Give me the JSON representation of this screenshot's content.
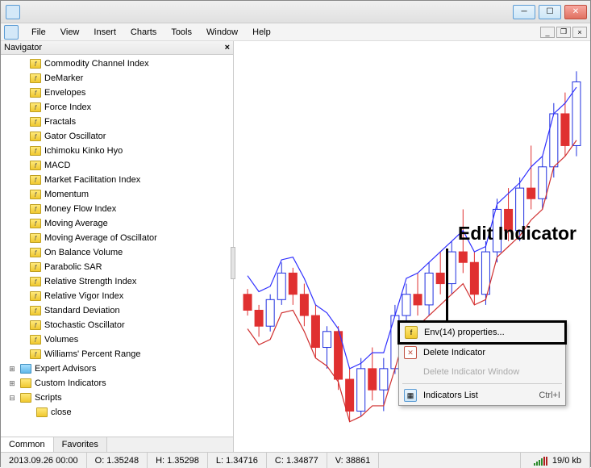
{
  "menubar": {
    "items": [
      "File",
      "View",
      "Insert",
      "Charts",
      "Tools",
      "Window",
      "Help"
    ]
  },
  "navigator": {
    "title": "Navigator",
    "tabs": {
      "active": "Common",
      "inactive": "Favorites"
    },
    "indicators": [
      "Commodity Channel Index",
      "DeMarker",
      "Envelopes",
      "Force Index",
      "Fractals",
      "Gator Oscillator",
      "Ichimoku Kinko Hyo",
      "MACD",
      "Market Facilitation Index",
      "Momentum",
      "Money Flow Index",
      "Moving Average",
      "Moving Average of Oscillator",
      "On Balance Volume",
      "Parabolic SAR",
      "Relative Strength Index",
      "Relative Vigor Index",
      "Standard Deviation",
      "Stochastic Oscillator",
      "Volumes",
      "Williams' Percent Range"
    ],
    "groups": {
      "expert_advisors": "Expert Advisors",
      "custom_indicators": "Custom Indicators",
      "scripts": "Scripts",
      "script_child": "close"
    }
  },
  "annotation": {
    "label": "Edit Indicator"
  },
  "context_menu": {
    "properties": "Env(14) properties...",
    "delete_indicator": "Delete Indicator",
    "delete_window": "Delete Indicator Window",
    "list": "Indicators List",
    "shortcut": "Ctrl+I"
  },
  "statusbar": {
    "datetime": "2013.09.26 00:00",
    "open": "O: 1.35248",
    "high": "H: 1.35298",
    "low": "L: 1.34716",
    "close": "C: 1.34877",
    "volume": "V: 38861",
    "traffic": "19/0 kb"
  },
  "chart_data": {
    "type": "candlestick",
    "series": [
      {
        "o": 1.349,
        "h": 1.3495,
        "l": 1.347,
        "c": 1.3475,
        "up": false
      },
      {
        "o": 1.3475,
        "h": 1.348,
        "l": 1.345,
        "c": 1.346,
        "up": false
      },
      {
        "o": 1.346,
        "h": 1.349,
        "l": 1.3455,
        "c": 1.3485,
        "up": true
      },
      {
        "o": 1.3485,
        "h": 1.352,
        "l": 1.348,
        "c": 1.351,
        "up": true
      },
      {
        "o": 1.351,
        "h": 1.3515,
        "l": 1.348,
        "c": 1.349,
        "up": false
      },
      {
        "o": 1.349,
        "h": 1.35,
        "l": 1.346,
        "c": 1.347,
        "up": false
      },
      {
        "o": 1.347,
        "h": 1.348,
        "l": 1.343,
        "c": 1.344,
        "up": false
      },
      {
        "o": 1.344,
        "h": 1.346,
        "l": 1.342,
        "c": 1.3455,
        "up": true
      },
      {
        "o": 1.3455,
        "h": 1.346,
        "l": 1.34,
        "c": 1.341,
        "up": false
      },
      {
        "o": 1.341,
        "h": 1.342,
        "l": 1.337,
        "c": 1.338,
        "up": false
      },
      {
        "o": 1.338,
        "h": 1.343,
        "l": 1.3375,
        "c": 1.342,
        "up": true
      },
      {
        "o": 1.342,
        "h": 1.344,
        "l": 1.339,
        "c": 1.34,
        "up": false
      },
      {
        "o": 1.34,
        "h": 1.343,
        "l": 1.338,
        "c": 1.342,
        "up": true
      },
      {
        "o": 1.342,
        "h": 1.348,
        "l": 1.3415,
        "c": 1.347,
        "up": true
      },
      {
        "o": 1.347,
        "h": 1.35,
        "l": 1.346,
        "c": 1.349,
        "up": true
      },
      {
        "o": 1.349,
        "h": 1.351,
        "l": 1.347,
        "c": 1.348,
        "up": false
      },
      {
        "o": 1.348,
        "h": 1.352,
        "l": 1.347,
        "c": 1.351,
        "up": true
      },
      {
        "o": 1.351,
        "h": 1.353,
        "l": 1.349,
        "c": 1.35,
        "up": false
      },
      {
        "o": 1.35,
        "h": 1.354,
        "l": 1.349,
        "c": 1.353,
        "up": true
      },
      {
        "o": 1.353,
        "h": 1.357,
        "l": 1.351,
        "c": 1.352,
        "up": false
      },
      {
        "o": 1.352,
        "h": 1.353,
        "l": 1.348,
        "c": 1.349,
        "up": false
      },
      {
        "o": 1.349,
        "h": 1.354,
        "l": 1.348,
        "c": 1.353,
        "up": true
      },
      {
        "o": 1.353,
        "h": 1.358,
        "l": 1.352,
        "c": 1.357,
        "up": true
      },
      {
        "o": 1.357,
        "h": 1.359,
        "l": 1.354,
        "c": 1.355,
        "up": false
      },
      {
        "o": 1.355,
        "h": 1.36,
        "l": 1.354,
        "c": 1.359,
        "up": true
      },
      {
        "o": 1.359,
        "h": 1.363,
        "l": 1.357,
        "c": 1.358,
        "up": false
      },
      {
        "o": 1.358,
        "h": 1.362,
        "l": 1.357,
        "c": 1.361,
        "up": true
      },
      {
        "o": 1.361,
        "h": 1.367,
        "l": 1.36,
        "c": 1.366,
        "up": true
      },
      {
        "o": 1.366,
        "h": 1.368,
        "l": 1.362,
        "c": 1.363,
        "up": false
      },
      {
        "o": 1.363,
        "h": 1.37,
        "l": 1.362,
        "c": 1.369,
        "up": true
      }
    ],
    "overlays": [
      {
        "name": "Envelope Upper",
        "color": "#3030ff"
      },
      {
        "name": "Envelope Lower",
        "color": "#d03030"
      }
    ],
    "ymin": 1.335,
    "ymax": 1.372
  }
}
